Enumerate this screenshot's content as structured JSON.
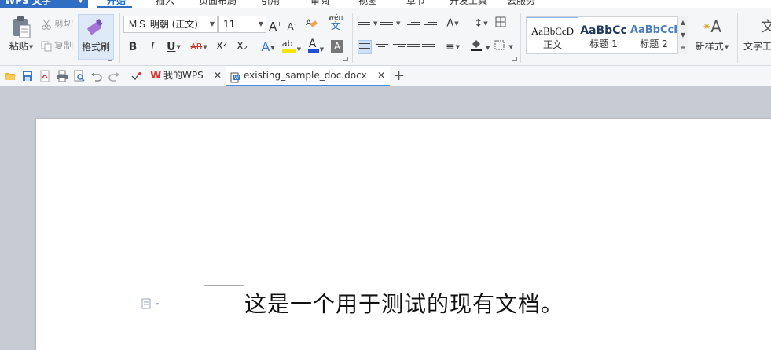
{
  "app": {
    "name": "WPS 文字",
    "accent_color": "#2f6ec2"
  },
  "menu": {
    "tabs": [
      "开始",
      "插入",
      "页面布局",
      "引用",
      "审阅",
      "视图",
      "章节",
      "开发工具",
      "云服务"
    ],
    "active_tab": "开始"
  },
  "ribbon": {
    "clipboard": {
      "paste": "粘贴",
      "cut": "剪切",
      "copy": "复制",
      "format_painter": "格式刷"
    },
    "font": {
      "font_name": "ＭＳ 明朝 (正文)",
      "font_size": "11",
      "bold": "B",
      "italic": "I",
      "underline": "U",
      "strike": "AB",
      "superscript": "X²",
      "subscript": "X₂",
      "grow": "A",
      "shrink": "A",
      "phonetic": "wén",
      "text_effect": "A",
      "highlight": "ab",
      "font_color": "A",
      "char_shading": "A"
    },
    "styles": {
      "items": [
        {
          "sample": "AaBbCcD",
          "name": "正文"
        },
        {
          "sample": "AaBbCc",
          "name": "标题 1"
        },
        {
          "sample": "AaBbCcI",
          "name": "标题 2"
        }
      ],
      "new_style": "新样式",
      "text_tools": "文字工"
    }
  },
  "tabs": {
    "home": "我的WPS",
    "document": "existing_sample_doc.docx"
  },
  "document": {
    "text": "这是一个用于测试的现有文档。"
  }
}
